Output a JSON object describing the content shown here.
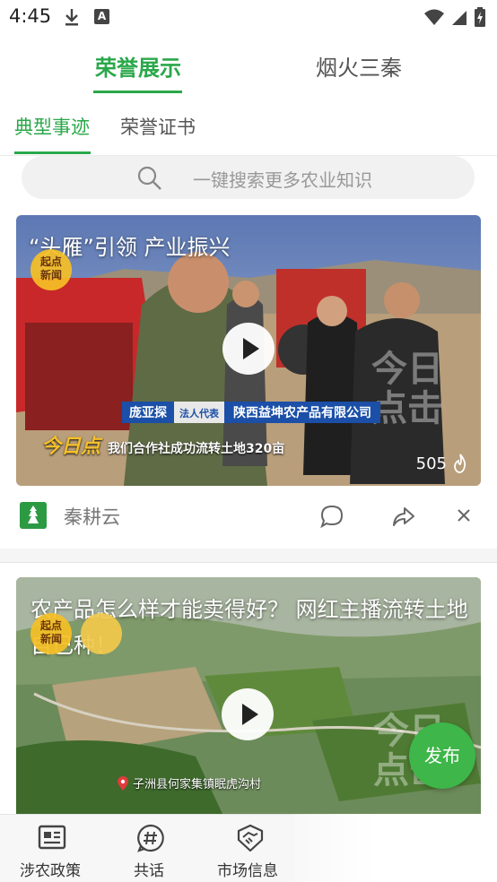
{
  "status_bar": {
    "time": "4:45",
    "badge_letter": "A"
  },
  "top_tabs": [
    {
      "label": "荣誉展示",
      "active": true
    },
    {
      "label": "烟火三秦",
      "active": false
    }
  ],
  "sub_tabs": [
    {
      "label": "典型事迹",
      "active": true
    },
    {
      "label": "荣誉证书",
      "active": false
    }
  ],
  "search": {
    "placeholder": "一键搜索更多农业知识"
  },
  "video1": {
    "title": "“头雁”引领 产业振兴",
    "logo_text": "起点\n新闻",
    "person_name": "庞亚探",
    "person_role": "法人代表",
    "company": "陕西益坤农产品有限公司",
    "caption": "我们合作社成功流转土地320亩",
    "channel_mark": "今日点",
    "watermark": "今日\n点击",
    "views": "505"
  },
  "video1_meta": {
    "source": "秦耕云"
  },
  "video2": {
    "title": "农产品怎么样才能卖得好？ 网红主播流转土地自己种！",
    "logo_text": "起点\n新闻",
    "location": "子洲县何家集镇眠虎沟村",
    "watermark": "今日\n点击"
  },
  "fab": {
    "label": "发布"
  },
  "bottom_nav": [
    {
      "label": "涉农政策",
      "icon": "policy-icon"
    },
    {
      "label": "共话",
      "icon": "hashtag-icon"
    },
    {
      "label": "市场信息",
      "icon": "handshake-icon"
    }
  ],
  "colors": {
    "accent": "#2aa84a",
    "fab": "#3eb649"
  }
}
